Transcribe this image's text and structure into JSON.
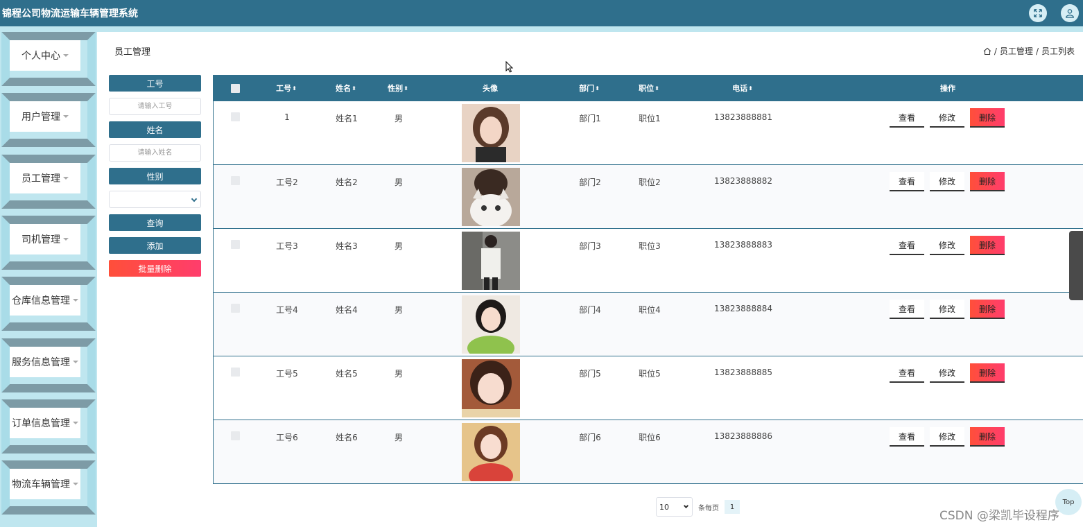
{
  "app": {
    "title": "锦程公司物流运输车辆管理系统"
  },
  "topbar": {
    "icons": [
      "fullscreen-icon",
      "user-icon"
    ]
  },
  "sidebar": {
    "items": [
      {
        "label": "个人中心"
      },
      {
        "label": "用户管理"
      },
      {
        "label": "员工管理"
      },
      {
        "label": "司机管理"
      },
      {
        "label": "仓库信息管理"
      },
      {
        "label": "服务信息管理"
      },
      {
        "label": "订单信息管理"
      },
      {
        "label": "物流车辆管理"
      }
    ]
  },
  "page": {
    "title": "员工管理"
  },
  "breadcrumb": {
    "items": [
      "员工管理",
      "员工列表"
    ],
    "separator": "/"
  },
  "search": {
    "id_label": "工号",
    "id_placeholder": "请输入工号",
    "name_label": "姓名",
    "name_placeholder": "请输入姓名",
    "gender_label": "性别",
    "gender_value": "",
    "query_button": "查询",
    "add_button": "添加",
    "batch_delete_button": "批量删除"
  },
  "table": {
    "headers": {
      "id": "工号",
      "name": "姓名",
      "gender": "性别",
      "photo": "头像",
      "dept": "部门",
      "position": "职位",
      "phone": "电话",
      "actions": "操作"
    },
    "sort_glyph": "⬍",
    "rows": [
      {
        "id": "1",
        "name": "姓名1",
        "gender": "男",
        "dept": "部门1",
        "position": "职位1",
        "phone": "13823888881"
      },
      {
        "id": "工号2",
        "name": "姓名2",
        "gender": "男",
        "dept": "部门2",
        "position": "职位2",
        "phone": "13823888882"
      },
      {
        "id": "工号3",
        "name": "姓名3",
        "gender": "男",
        "dept": "部门3",
        "position": "职位3",
        "phone": "13823888883"
      },
      {
        "id": "工号4",
        "name": "姓名4",
        "gender": "男",
        "dept": "部门4",
        "position": "职位4",
        "phone": "13823888884"
      },
      {
        "id": "工号5",
        "name": "姓名5",
        "gender": "男",
        "dept": "部门5",
        "position": "职位5",
        "phone": "13823888885"
      },
      {
        "id": "工号6",
        "name": "姓名6",
        "gender": "男",
        "dept": "部门6",
        "position": "职位6",
        "phone": "13823888886"
      }
    ],
    "actions": {
      "view": "查看",
      "edit": "修改",
      "delete": "删除"
    }
  },
  "pagination": {
    "page_size": "10",
    "page_size_label": "条每页",
    "current_page": "1"
  },
  "top_button": "Top",
  "watermark": "CSDN @梁凯毕设程序",
  "colors": {
    "primary": "#2f6f8c",
    "accent_light": "#bfe6ef",
    "danger": "#ff4a4a"
  }
}
